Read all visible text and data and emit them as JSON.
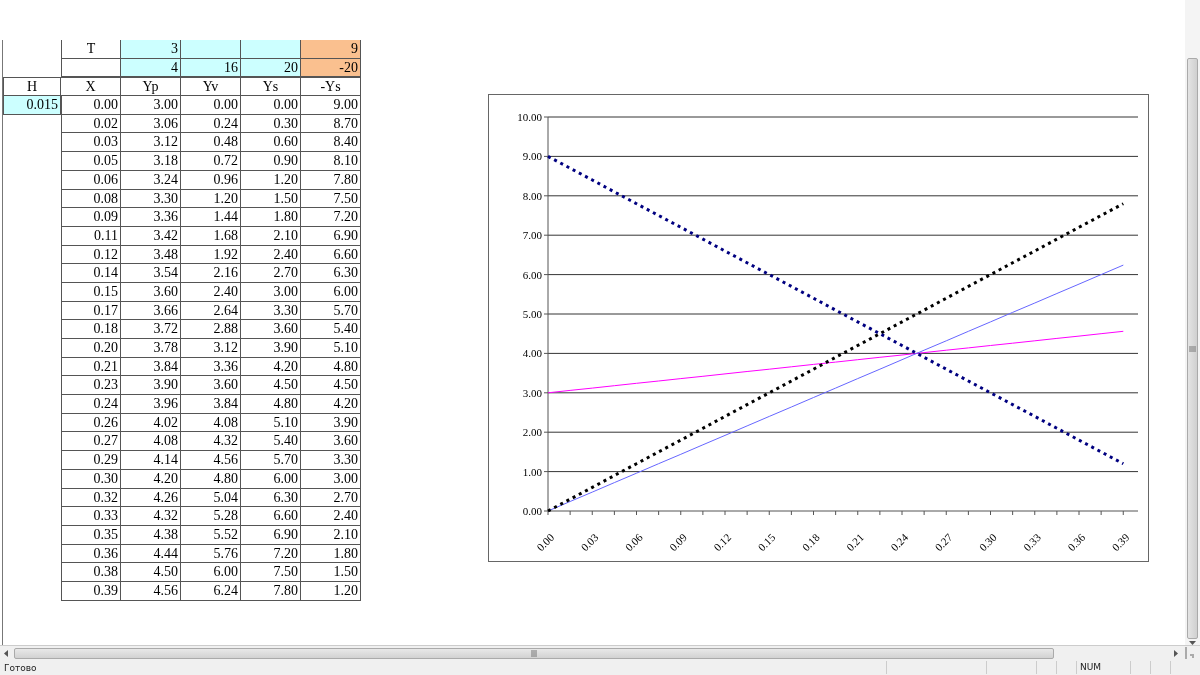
{
  "sheet": {
    "top_rows": [
      {
        "label": "T",
        "values": [
          {
            "text": "3",
            "color": "#ccffff"
          },
          {
            "color": "#ccffff"
          },
          {
            "color": "#ccffff"
          },
          {
            "text": "9",
            "color": "#fac08f"
          }
        ]
      },
      {
        "values": [
          {
            "text": "4",
            "color": "#ccffff"
          },
          {
            "text": "16",
            "color": "#ccffff"
          },
          {
            "text": "20",
            "color": "#ccffff"
          },
          {
            "text": "-20",
            "color": "#fac08f"
          }
        ]
      }
    ],
    "columns": [
      "H",
      "X",
      "Yp",
      "Yv",
      "Ys",
      "-Ys"
    ],
    "step": {
      "text": "0.015",
      "color": "#ccffff"
    },
    "rows": [
      [
        "0.00",
        "3.00",
        "0.00",
        "0.00",
        "9.00"
      ],
      [
        "0.02",
        "3.06",
        "0.24",
        "0.30",
        "8.70"
      ],
      [
        "0.03",
        "3.12",
        "0.48",
        "0.60",
        "8.40"
      ],
      [
        "0.05",
        "3.18",
        "0.72",
        "0.90",
        "8.10"
      ],
      [
        "0.06",
        "3.24",
        "0.96",
        "1.20",
        "7.80"
      ],
      [
        "0.08",
        "3.30",
        "1.20",
        "1.50",
        "7.50"
      ],
      [
        "0.09",
        "3.36",
        "1.44",
        "1.80",
        "7.20"
      ],
      [
        "0.11",
        "3.42",
        "1.68",
        "2.10",
        "6.90"
      ],
      [
        "0.12",
        "3.48",
        "1.92",
        "2.40",
        "6.60"
      ],
      [
        "0.14",
        "3.54",
        "2.16",
        "2.70",
        "6.30"
      ],
      [
        "0.15",
        "3.60",
        "2.40",
        "3.00",
        "6.00"
      ],
      [
        "0.17",
        "3.66",
        "2.64",
        "3.30",
        "5.70"
      ],
      [
        "0.18",
        "3.72",
        "2.88",
        "3.60",
        "5.40"
      ],
      [
        "0.20",
        "3.78",
        "3.12",
        "3.90",
        "5.10"
      ],
      [
        "0.21",
        "3.84",
        "3.36",
        "4.20",
        "4.80"
      ],
      [
        "0.23",
        "3.90",
        "3.60",
        "4.50",
        "4.50"
      ],
      [
        "0.24",
        "3.96",
        "3.84",
        "4.80",
        "4.20"
      ],
      [
        "0.26",
        "4.02",
        "4.08",
        "5.10",
        "3.90"
      ],
      [
        "0.27",
        "4.08",
        "4.32",
        "5.40",
        "3.60"
      ],
      [
        "0.29",
        "4.14",
        "4.56",
        "5.70",
        "3.30"
      ],
      [
        "0.30",
        "4.20",
        "4.80",
        "6.00",
        "3.00"
      ],
      [
        "0.32",
        "4.26",
        "5.04",
        "6.30",
        "2.70"
      ],
      [
        "0.33",
        "4.32",
        "5.28",
        "6.60",
        "2.40"
      ],
      [
        "0.35",
        "4.38",
        "5.52",
        "6.90",
        "2.10"
      ],
      [
        "0.36",
        "4.44",
        "5.76",
        "7.20",
        "1.80"
      ],
      [
        "0.38",
        "4.50",
        "6.00",
        "7.50",
        "1.50"
      ],
      [
        "0.39",
        "4.56",
        "6.24",
        "7.80",
        "1.20"
      ]
    ]
  },
  "chart": {
    "chart_data": {
      "type": "line",
      "grid": true,
      "xlim": [
        0,
        0.4
      ],
      "x": [
        0,
        0.015,
        0.03,
        0.045,
        0.06,
        0.075,
        0.09,
        0.105,
        0.12,
        0.135,
        0.15,
        0.165,
        0.18,
        0.195,
        0.21,
        0.225,
        0.24,
        0.255,
        0.27,
        0.285,
        0.3,
        0.315,
        0.33,
        0.345,
        0.36,
        0.375,
        0.39
      ],
      "xticks": [
        {
          "value": 0,
          "label": "0.00"
        },
        {
          "value": 0.03,
          "label": "0.03"
        },
        {
          "value": 0.06,
          "label": "0.06"
        },
        {
          "value": 0.09,
          "label": "0.09"
        },
        {
          "value": 0.12,
          "label": "0.12"
        },
        {
          "value": 0.15,
          "label": "0.15"
        },
        {
          "value": 0.18,
          "label": "0.18"
        },
        {
          "value": 0.21,
          "label": "0.21"
        },
        {
          "value": 0.24,
          "label": "0.24"
        },
        {
          "value": 0.27,
          "label": "0.27"
        },
        {
          "value": 0.3,
          "label": "0.30"
        },
        {
          "value": 0.33,
          "label": "0.33"
        },
        {
          "value": 0.36,
          "label": "0.36"
        },
        {
          "value": 0.39,
          "label": "0.39"
        }
      ],
      "ylim": [
        0,
        10
      ],
      "yticks": [
        {
          "value": 0,
          "label": "0.00"
        },
        {
          "value": 1,
          "label": "1.00"
        },
        {
          "value": 2,
          "label": "2.00"
        },
        {
          "value": 3,
          "label": "3.00"
        },
        {
          "value": 4,
          "label": "4.00"
        },
        {
          "value": 5,
          "label": "5.00"
        },
        {
          "value": 6,
          "label": "6.00"
        },
        {
          "value": 7,
          "label": "7.00"
        },
        {
          "value": 8,
          "label": "8.00"
        },
        {
          "value": 9,
          "label": "9.00"
        },
        {
          "value": 10,
          "label": "10.00"
        }
      ],
      "series": [
        {
          "color": "#ff00ff",
          "line_style": "solid",
          "values": [
            3.0,
            3.06,
            3.12,
            3.18,
            3.24,
            3.3,
            3.36,
            3.42,
            3.48,
            3.54,
            3.6,
            3.66,
            3.72,
            3.78,
            3.84,
            3.9,
            3.96,
            4.02,
            4.08,
            4.14,
            4.2,
            4.26,
            4.32,
            4.38,
            4.44,
            4.5,
            4.56
          ]
        },
        {
          "color": "#6666ff",
          "line_style": "solid",
          "values": [
            0.0,
            0.24,
            0.48,
            0.72,
            0.96,
            1.2,
            1.44,
            1.68,
            1.92,
            2.16,
            2.4,
            2.64,
            2.88,
            3.12,
            3.36,
            3.6,
            3.84,
            4.08,
            4.32,
            4.56,
            4.8,
            5.04,
            5.28,
            5.52,
            5.76,
            6.0,
            6.24
          ]
        },
        {
          "color": "#000000",
          "line_style": "dotted",
          "values": [
            0.0,
            0.3,
            0.6,
            0.9,
            1.2,
            1.5,
            1.8,
            2.1,
            2.4,
            2.7,
            3.0,
            3.3,
            3.6,
            3.9,
            4.2,
            4.5,
            4.8,
            5.1,
            5.4,
            5.7,
            6.0,
            6.3,
            6.6,
            6.9,
            7.2,
            7.5,
            7.8
          ]
        },
        {
          "color": "#000080",
          "line_style": "dotted",
          "values": [
            9.0,
            8.7,
            8.4,
            8.1,
            7.8,
            7.5,
            7.2,
            6.9,
            6.6,
            6.3,
            6.0,
            5.7,
            5.4,
            5.1,
            4.8,
            4.5,
            4.2,
            3.9,
            3.6,
            3.3,
            3.0,
            2.7,
            2.4,
            2.1,
            1.8,
            1.5,
            1.2
          ]
        }
      ]
    }
  },
  "status_bar": {
    "status": "Готово",
    "indicator": "NUM"
  }
}
